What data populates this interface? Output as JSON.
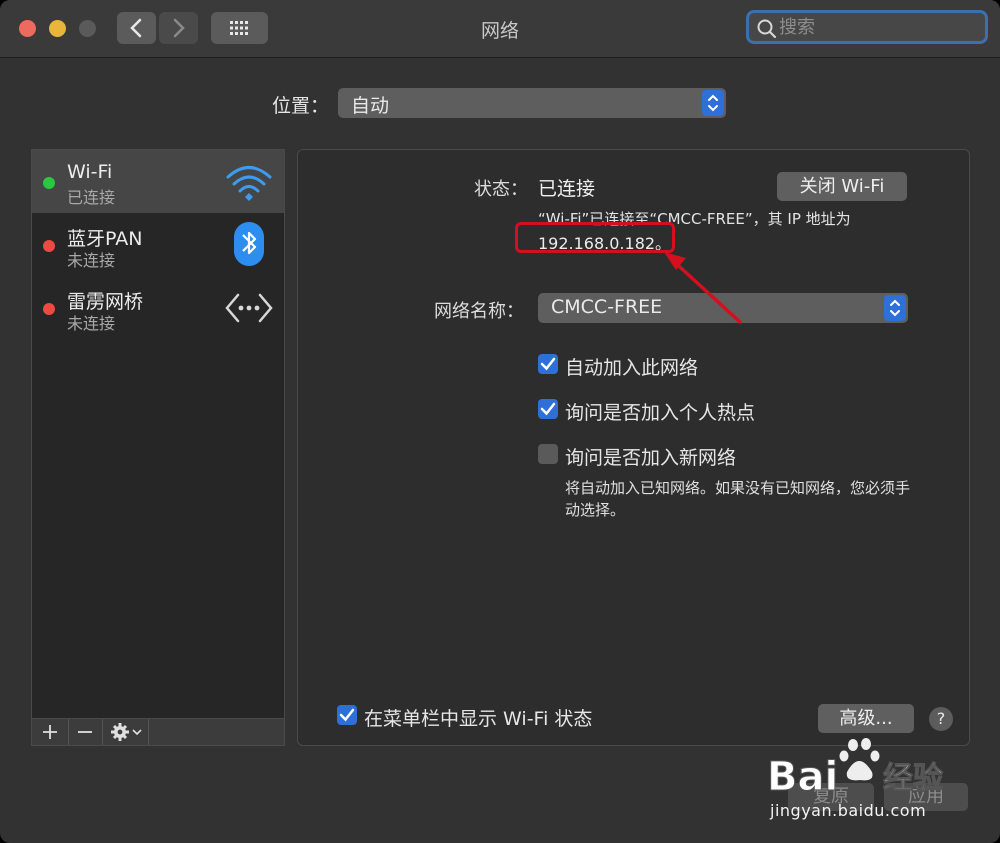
{
  "window": {
    "title": "网络"
  },
  "search": {
    "placeholder": "搜索"
  },
  "location": {
    "label": "位置：",
    "value": "自动"
  },
  "sidebar": {
    "services": [
      {
        "name": "Wi-Fi",
        "status": "已连接",
        "dot_color": "#28c840",
        "icon": "wifi-icon"
      },
      {
        "name": "蓝牙PAN",
        "status": "未连接",
        "dot_color": "#ec4b44",
        "icon": "bluetooth-icon"
      },
      {
        "name": "雷雳网桥",
        "status": "未连接",
        "dot_color": "#ec4b44",
        "icon": "thunderbolt-bridge-icon"
      }
    ],
    "toolbar": {
      "add": "+",
      "remove": "−"
    }
  },
  "panel": {
    "status_label": "状态：",
    "status_value": "已连接",
    "turn_off_button": "关闭 Wi-Fi",
    "status_desc": "“Wi-Fi”已连接至“CMCC-FREE”，其 IP 地址为",
    "ip": "192.168.0.182。",
    "network_name_label": "网络名称：",
    "network_name_value": "CMCC-FREE",
    "checkboxes": [
      {
        "label": "自动加入此网络",
        "checked": true
      },
      {
        "label": "询问是否加入个人热点",
        "checked": true
      },
      {
        "label": "询问是否加入新网络",
        "checked": false
      }
    ],
    "hint": "将自动加入已知网络。如果没有已知网络，您必须手动选择。",
    "menubar_checkbox": {
      "label": "在菜单栏中显示 Wi-Fi 状态",
      "checked": true
    },
    "advanced_button": "高级...",
    "help": "?"
  },
  "footer": {
    "revert_button": "复原",
    "apply_button": "应用"
  },
  "watermark": {
    "brand": "Bai",
    "brand2": "经验",
    "url": "jingyan.baidu.com"
  },
  "colors": {
    "accent": "#2f6fd8",
    "highlight": "#d40f1e",
    "window_bg": "#323232"
  }
}
